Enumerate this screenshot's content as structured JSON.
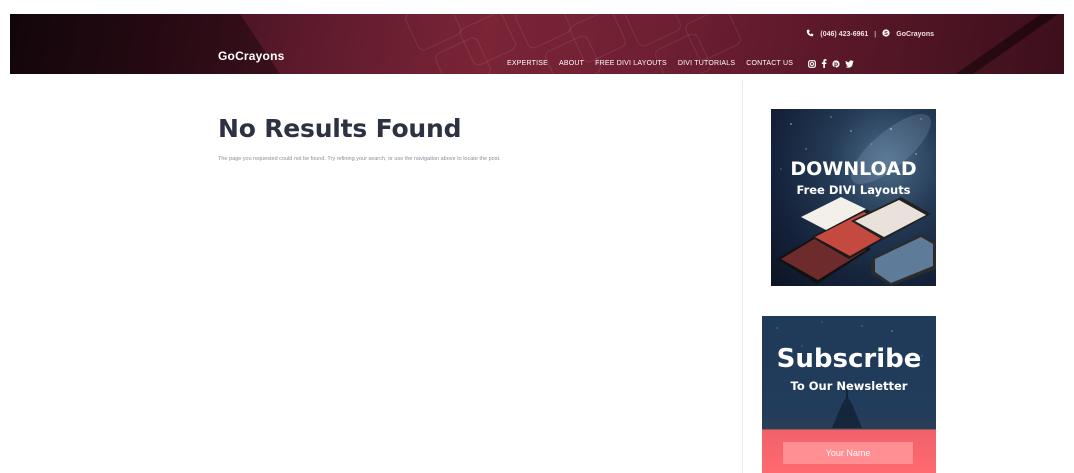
{
  "header": {
    "logo": "GoCrayons",
    "phone": "(046) 423-6961",
    "separator": "|",
    "skype": "GoCrayons",
    "nav": [
      "EXPERTISE",
      "ABOUT",
      "FREE DIVI LAYOUTS",
      "DIVI TUTORIALS",
      "CONTACT US"
    ],
    "social_icons": [
      "instagram-icon",
      "facebook-icon",
      "pinterest-icon",
      "twitter-icon"
    ]
  },
  "main": {
    "title": "No Results Found",
    "message": "The page you requested could not be found. Try refining your search, or use the navigation above to locate the post."
  },
  "sidebar": {
    "download_ad": {
      "title": "DOWNLOAD",
      "subtitle": "Free DIVI Layouts"
    },
    "subscribe_ad": {
      "title": "Subscribe",
      "subtitle": "To Our Newsletter",
      "name_placeholder": "Your Name"
    }
  },
  "colors": {
    "header_bg": "#5c1a2c",
    "title_text": "#2d3142",
    "subscribe_bg": "#223c5b",
    "subscribe_accent": "#ff6a6f"
  }
}
